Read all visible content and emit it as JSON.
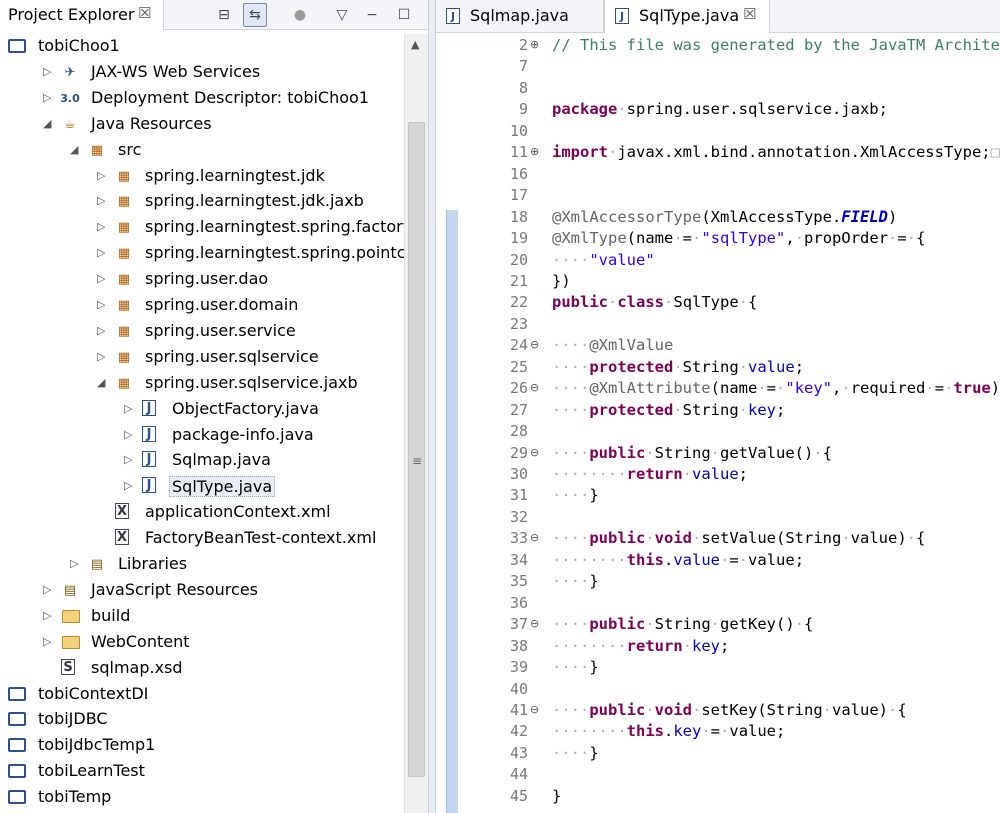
{
  "explorer": {
    "title": "Project Explorer",
    "close": "☒"
  },
  "tree": [
    {
      "depth": 0,
      "arrow": "",
      "icon": "proj",
      "label": "tobiChoo1"
    },
    {
      "depth": 1,
      "arrow": "▷",
      "icon": "ws",
      "label": "JAX-WS Web Services"
    },
    {
      "depth": 1,
      "arrow": "▷",
      "icon": "dd",
      "label": "Deployment Descriptor: tobiChoo1"
    },
    {
      "depth": 1,
      "arrow": "◢",
      "icon": "jr",
      "label": "Java Resources"
    },
    {
      "depth": 2,
      "arrow": "◢",
      "icon": "src",
      "label": "src"
    },
    {
      "depth": 3,
      "arrow": "▷",
      "icon": "pkg",
      "label": "spring.learningtest.jdk"
    },
    {
      "depth": 3,
      "arrow": "▷",
      "icon": "pkg",
      "label": "spring.learningtest.jdk.jaxb"
    },
    {
      "depth": 3,
      "arrow": "▷",
      "icon": "pkg",
      "label": "spring.learningtest.spring.factorybear"
    },
    {
      "depth": 3,
      "arrow": "▷",
      "icon": "pkg",
      "label": "spring.learningtest.spring.pointcut"
    },
    {
      "depth": 3,
      "arrow": "▷",
      "icon": "pkg",
      "label": "spring.user.dao"
    },
    {
      "depth": 3,
      "arrow": "▷",
      "icon": "pkg",
      "label": "spring.user.domain"
    },
    {
      "depth": 3,
      "arrow": "▷",
      "icon": "pkg",
      "label": "spring.user.service"
    },
    {
      "depth": 3,
      "arrow": "▷",
      "icon": "pkg",
      "label": "spring.user.sqlservice"
    },
    {
      "depth": 3,
      "arrow": "◢",
      "icon": "pkg",
      "label": "spring.user.sqlservice.jaxb"
    },
    {
      "depth": 4,
      "arrow": "▷",
      "icon": "java",
      "label": "ObjectFactory.java"
    },
    {
      "depth": 4,
      "arrow": "▷",
      "icon": "java",
      "label": "package-info.java"
    },
    {
      "depth": 4,
      "arrow": "▷",
      "icon": "java",
      "label": "Sqlmap.java"
    },
    {
      "depth": 4,
      "arrow": "▷",
      "icon": "java",
      "label": "SqlType.java",
      "selected": true
    },
    {
      "depth": 3,
      "arrow": "",
      "icon": "xml",
      "label": "applicationContext.xml"
    },
    {
      "depth": 3,
      "arrow": "",
      "icon": "xml",
      "label": "FactoryBeanTest-context.xml"
    },
    {
      "depth": 2,
      "arrow": "▷",
      "icon": "lib",
      "label": "Libraries"
    },
    {
      "depth": 1,
      "arrow": "▷",
      "icon": "lib",
      "label": "JavaScript Resources"
    },
    {
      "depth": 1,
      "arrow": "▷",
      "icon": "folder",
      "label": "build"
    },
    {
      "depth": 1,
      "arrow": "▷",
      "icon": "folder",
      "label": "WebContent"
    },
    {
      "depth": 1,
      "arrow": "",
      "icon": "xsd",
      "label": "sqlmap.xsd"
    },
    {
      "depth": 0,
      "arrow": "",
      "icon": "proj",
      "label": "tobiContextDI"
    },
    {
      "depth": 0,
      "arrow": "",
      "icon": "proj",
      "label": "tobiJDBC"
    },
    {
      "depth": 0,
      "arrow": "",
      "icon": "proj",
      "label": "tobiJdbcTemp1"
    },
    {
      "depth": 0,
      "arrow": "",
      "icon": "proj",
      "label": "tobiLearnTest"
    },
    {
      "depth": 0,
      "arrow": "",
      "icon": "proj",
      "label": "tobiTemp"
    }
  ],
  "editor": {
    "tabs": [
      {
        "label": "Sqlmap.java",
        "active": false
      },
      {
        "label": "SqlType.java",
        "active": true,
        "close": "☒"
      }
    ]
  },
  "code": [
    {
      "n": "2",
      "fold": "⊕",
      "segs": [
        [
          "cm",
          "// This file was generated by the JavaTM Architect"
        ]
      ]
    },
    {
      "n": "7",
      "segs": []
    },
    {
      "n": "8",
      "segs": []
    },
    {
      "n": "9",
      "segs": [
        [
          "kw",
          "package"
        ],
        [
          "dt",
          "·"
        ],
        [
          "",
          "spring.user.sqlservice.jaxb;"
        ]
      ]
    },
    {
      "n": "10",
      "segs": []
    },
    {
      "n": "11",
      "fold": "⊕",
      "segs": [
        [
          "kw",
          "import"
        ],
        [
          "dt",
          "·"
        ],
        [
          "",
          "javax.xml.bind.annotation.XmlAccessType;"
        ],
        [
          "dt",
          "□"
        ]
      ]
    },
    {
      "n": "16",
      "segs": []
    },
    {
      "n": "17",
      "segs": []
    },
    {
      "n": "18",
      "segs": [
        [
          "an",
          "@XmlAccessorType"
        ],
        [
          "",
          "(XmlAccessType."
        ],
        [
          "fi",
          "FIELD"
        ],
        [
          "",
          ")"
        ]
      ]
    },
    {
      "n": "19",
      "segs": [
        [
          "an",
          "@XmlType"
        ],
        [
          "",
          "(name"
        ],
        [
          "dt",
          "·"
        ],
        [
          "",
          "="
        ],
        [
          "dt",
          "·"
        ],
        [
          "st",
          "\"sqlType\""
        ],
        [
          "",
          ","
        ],
        [
          "dt",
          "·"
        ],
        [
          "",
          "propOrder"
        ],
        [
          "dt",
          "·"
        ],
        [
          "",
          "="
        ],
        [
          "dt",
          "·"
        ],
        [
          "",
          "{"
        ]
      ]
    },
    {
      "n": "20",
      "segs": [
        [
          "dt",
          "····"
        ],
        [
          "st",
          "\"value\""
        ]
      ]
    },
    {
      "n": "21",
      "segs": [
        [
          "",
          "})"
        ]
      ]
    },
    {
      "n": "22",
      "segs": [
        [
          "kw",
          "public"
        ],
        [
          "dt",
          "·"
        ],
        [
          "kw",
          "class"
        ],
        [
          "dt",
          "·"
        ],
        [
          "",
          "SqlType"
        ],
        [
          "dt",
          "·"
        ],
        [
          "",
          "{"
        ]
      ]
    },
    {
      "n": "23",
      "segs": []
    },
    {
      "n": "24",
      "fold": "⊖",
      "segs": [
        [
          "dt",
          "····"
        ],
        [
          "an",
          "@XmlValue"
        ]
      ]
    },
    {
      "n": "25",
      "segs": [
        [
          "dt",
          "····"
        ],
        [
          "kw",
          "protected"
        ],
        [
          "dt",
          "·"
        ],
        [
          "",
          "String"
        ],
        [
          "dt",
          "·"
        ],
        [
          "fd",
          "value"
        ],
        [
          "",
          ";"
        ]
      ]
    },
    {
      "n": "26",
      "fold": "⊖",
      "segs": [
        [
          "dt",
          "····"
        ],
        [
          "an",
          "@XmlAttribute"
        ],
        [
          "",
          "(name"
        ],
        [
          "dt",
          "·"
        ],
        [
          "",
          "="
        ],
        [
          "dt",
          "·"
        ],
        [
          "st",
          "\"key\""
        ],
        [
          "",
          ","
        ],
        [
          "dt",
          "·"
        ],
        [
          "",
          "required"
        ],
        [
          "dt",
          "·"
        ],
        [
          "",
          "="
        ],
        [
          "dt",
          "·"
        ],
        [
          "kw",
          "true"
        ],
        [
          "",
          ")"
        ]
      ]
    },
    {
      "n": "27",
      "segs": [
        [
          "dt",
          "····"
        ],
        [
          "kw",
          "protected"
        ],
        [
          "dt",
          "·"
        ],
        [
          "",
          "String"
        ],
        [
          "dt",
          "·"
        ],
        [
          "fd",
          "key"
        ],
        [
          "",
          ";"
        ]
      ]
    },
    {
      "n": "28",
      "segs": []
    },
    {
      "n": "29",
      "fold": "⊖",
      "segs": [
        [
          "dt",
          "····"
        ],
        [
          "kw",
          "public"
        ],
        [
          "dt",
          "·"
        ],
        [
          "",
          "String"
        ],
        [
          "dt",
          "·"
        ],
        [
          "",
          "getValue()"
        ],
        [
          "dt",
          "·"
        ],
        [
          "",
          "{"
        ]
      ]
    },
    {
      "n": "30",
      "segs": [
        [
          "dt",
          "········"
        ],
        [
          "kw",
          "return"
        ],
        [
          "dt",
          "·"
        ],
        [
          "fd",
          "value"
        ],
        [
          "",
          ";"
        ]
      ]
    },
    {
      "n": "31",
      "segs": [
        [
          "dt",
          "····"
        ],
        [
          "",
          "}"
        ]
      ]
    },
    {
      "n": "32",
      "segs": []
    },
    {
      "n": "33",
      "fold": "⊖",
      "segs": [
        [
          "dt",
          "····"
        ],
        [
          "kw",
          "public"
        ],
        [
          "dt",
          "·"
        ],
        [
          "kw",
          "void"
        ],
        [
          "dt",
          "·"
        ],
        [
          "",
          "setValue(String"
        ],
        [
          "dt",
          "·"
        ],
        [
          "",
          "value)"
        ],
        [
          "dt",
          "·"
        ],
        [
          "",
          "{"
        ]
      ]
    },
    {
      "n": "34",
      "segs": [
        [
          "dt",
          "········"
        ],
        [
          "kw",
          "this"
        ],
        [
          "",
          "."
        ],
        [
          "fd",
          "value"
        ],
        [
          "dt",
          "·"
        ],
        [
          "",
          "="
        ],
        [
          "dt",
          "·"
        ],
        [
          "",
          "value;"
        ]
      ]
    },
    {
      "n": "35",
      "segs": [
        [
          "dt",
          "····"
        ],
        [
          "",
          "}"
        ]
      ]
    },
    {
      "n": "36",
      "segs": []
    },
    {
      "n": "37",
      "fold": "⊖",
      "segs": [
        [
          "dt",
          "····"
        ],
        [
          "kw",
          "public"
        ],
        [
          "dt",
          "·"
        ],
        [
          "",
          "String"
        ],
        [
          "dt",
          "·"
        ],
        [
          "",
          "getKey()"
        ],
        [
          "dt",
          "·"
        ],
        [
          "",
          "{"
        ]
      ]
    },
    {
      "n": "38",
      "segs": [
        [
          "dt",
          "········"
        ],
        [
          "kw",
          "return"
        ],
        [
          "dt",
          "·"
        ],
        [
          "fd",
          "key"
        ],
        [
          "",
          ";"
        ]
      ]
    },
    {
      "n": "39",
      "segs": [
        [
          "dt",
          "····"
        ],
        [
          "",
          "}"
        ]
      ]
    },
    {
      "n": "40",
      "segs": []
    },
    {
      "n": "41",
      "fold": "⊖",
      "segs": [
        [
          "dt",
          "····"
        ],
        [
          "kw",
          "public"
        ],
        [
          "dt",
          "·"
        ],
        [
          "kw",
          "void"
        ],
        [
          "dt",
          "·"
        ],
        [
          "",
          "setKey(String"
        ],
        [
          "dt",
          "·"
        ],
        [
          "",
          "value)"
        ],
        [
          "dt",
          "·"
        ],
        [
          "",
          "{"
        ]
      ]
    },
    {
      "n": "42",
      "segs": [
        [
          "dt",
          "········"
        ],
        [
          "kw",
          "this"
        ],
        [
          "",
          "."
        ],
        [
          "fd",
          "key"
        ],
        [
          "dt",
          "·"
        ],
        [
          "",
          "="
        ],
        [
          "dt",
          "·"
        ],
        [
          "",
          "value;"
        ]
      ]
    },
    {
      "n": "43",
      "segs": [
        [
          "dt",
          "····"
        ],
        [
          "",
          "}"
        ]
      ]
    },
    {
      "n": "44",
      "segs": []
    },
    {
      "n": "45",
      "segs": [
        [
          "",
          "}"
        ]
      ]
    }
  ]
}
